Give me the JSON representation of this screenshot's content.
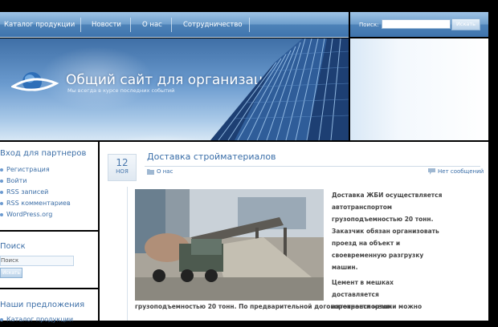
{
  "nav": {
    "items": [
      "Каталог продукции",
      "Новости",
      "О нас",
      "Сотрудничество"
    ]
  },
  "top_search": {
    "label": "Поиск:",
    "input_value": "",
    "button_label": "Искать"
  },
  "header": {
    "title": "Общий сайт для организаций",
    "tagline": "Мы всегда в курсе последних событий"
  },
  "sidebar": {
    "partners": {
      "title": "Вход для партнеров",
      "items": [
        "Регистрация",
        "Войти",
        "RSS записей",
        "RSS комментариев",
        "WordPress.org"
      ]
    },
    "search": {
      "title": "Поиск",
      "input_value": "Поиск",
      "button_label": "Искать"
    },
    "offers": {
      "title": "Наши предложения",
      "items": [
        "Каталог продукции"
      ]
    }
  },
  "post": {
    "date_day": "12",
    "date_month": "НОЯ",
    "title": "Доставка стройматериалов",
    "category": "О нас",
    "comments": "Нет сообщений",
    "paragraph1_lines": [
      "Доставка ЖБИ осуществляется",
      "автотранспортом",
      "грузоподъемностью 20 тонн.",
      "Заказчик обязан организовать",
      "проезд на объект и",
      "своевременную разгрузку",
      "машин."
    ],
    "paragraph2_lines": [
      "Цемент в мешках",
      "доставляется",
      "автотранспортом"
    ],
    "bottom_line": "грузоподъемностью 20 тонн. По предварительной договоренности мешки можно"
  }
}
